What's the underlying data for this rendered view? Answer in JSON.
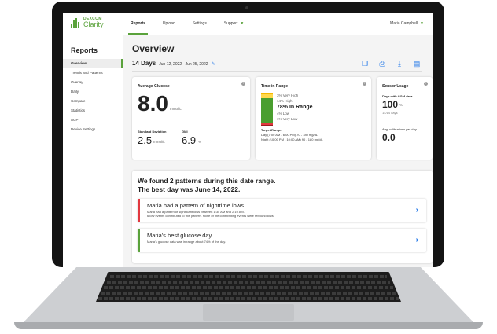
{
  "app": {
    "logo_brand": "DEXCOM",
    "logo_product": "Clarity"
  },
  "topnav": {
    "tabs": [
      "Reports",
      "Upload",
      "Settings",
      "Support"
    ],
    "user": "Maria Campbell"
  },
  "sidebar": {
    "title": "Reports",
    "items": [
      "Overview",
      "Trends and Patterns",
      "Overlay",
      "Daily",
      "Compare",
      "Statistics",
      "AGP",
      "Device Settings"
    ]
  },
  "main": {
    "title": "Overview",
    "days": "14 Days",
    "date_range": "Jun 12, 2022 - Jun 25, 2022"
  },
  "avg_glucose": {
    "title": "Average Glucose",
    "value": "8.0",
    "unit": "mmol/L",
    "sd_label": "Standard Deviation",
    "sd_value": "2.5",
    "sd_unit": "mmol/L",
    "gmi_label": "GMI",
    "gmi_value": "6.9",
    "gmi_unit": "%"
  },
  "time_in_range": {
    "title": "Time in Range",
    "very_high": "3% Very High",
    "high": "14% High",
    "in_range": "78% In Range",
    "low": "4% Low",
    "very_low": "1% Very Low",
    "target_label": "Target Range:",
    "target_day": "Day (7:00 AM - 6:00 PM) 70 - 180 mg/dL",
    "target_night": "Night (10:00 PM - 10:00 AM) 90 - 180 mg/dL",
    "segments": [
      {
        "name": "very-high",
        "pct": 3,
        "color": "#f5b700"
      },
      {
        "name": "high",
        "pct": 14,
        "color": "#ffd84d"
      },
      {
        "name": "in-range",
        "pct": 78,
        "color": "#4a9e2f"
      },
      {
        "name": "low",
        "pct": 4,
        "color": "#e2383f"
      },
      {
        "name": "very-low",
        "pct": 1,
        "color": "#9c1c22"
      }
    ]
  },
  "sensor_usage": {
    "title": "Sensor Usage",
    "days_label": "Days with CGM data",
    "days_value": "100",
    "days_unit": "%",
    "days_sub": "14/14 days",
    "cal_label": "Avg. calibrations per day",
    "cal_value": "0.0"
  },
  "patterns": {
    "heading_line1": "We found 2 patterns during this date range.",
    "heading_line2": "The best day was June 14, 2022.",
    "items": [
      {
        "title": "Maria had a pattern of nighttime lows",
        "desc1": "Maria had a pattern of significant lows between 1:35 AM and 2:10 AM.",
        "desc2": "6 low events contributed to this pattern. None of the contributing events were rebound lows.",
        "color": "#e2383f"
      },
      {
        "title": "Maria's best glucose day",
        "desc1": "Maria's glucose data was in range about 74% of the day.",
        "color": "#5aa23b"
      }
    ]
  },
  "icons": [
    "copy-icon",
    "print-icon",
    "download-icon",
    "save-icon",
    "pencil-icon",
    "chevron-right-icon",
    "help-icon"
  ]
}
